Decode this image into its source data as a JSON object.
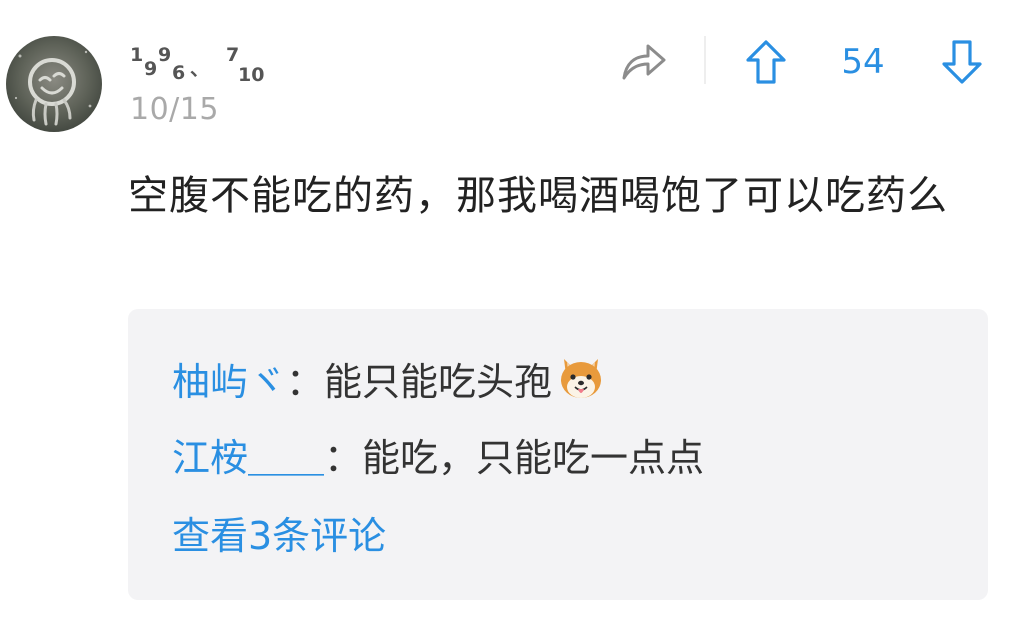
{
  "post": {
    "user": {
      "name_chars": [
        "1",
        "9",
        "9",
        "6",
        "、",
        "7",
        "10"
      ],
      "date": "10/15"
    },
    "actions": {
      "vote_count": "54"
    },
    "content": "空腹不能吃的药，那我喝酒喝饱了可以吃药么"
  },
  "replies": [
    {
      "author": "柚屿ヾ",
      "separator": "：",
      "text": "能只能吃头孢",
      "emoji": "shiba-dog-emoji"
    },
    {
      "author": "江桉＿＿",
      "separator": "：",
      "text": "能吃，只能吃一点点"
    }
  ],
  "view_more_label": "查看3条评论",
  "colors": {
    "accent": "#2a8fe2",
    "reply_background": "#f3f3f5",
    "timestamp": "#a9a9a9"
  },
  "icons": {
    "share": "share-arrow-icon",
    "upvote": "upvote-arrow-icon",
    "downvote": "downvote-arrow-icon",
    "avatar": "smiley-face-avatar"
  }
}
